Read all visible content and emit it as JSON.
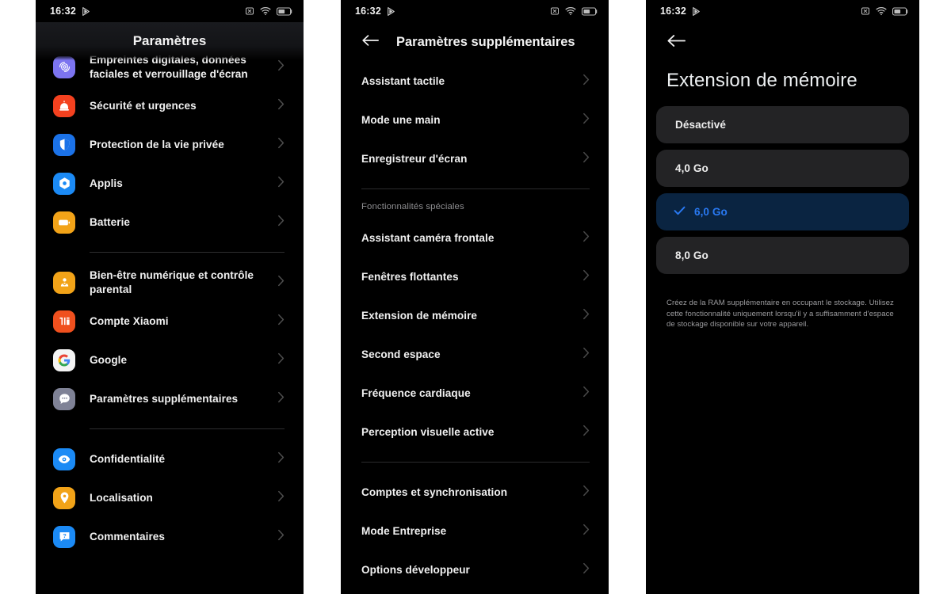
{
  "statusbar": {
    "time": "16:32",
    "play_icon": "play-triangle-icon",
    "icons": [
      "silent-mode-icon",
      "wifi-icon",
      "battery-icon"
    ],
    "battery_level": "53"
  },
  "panel1": {
    "header_title": "Paramètres",
    "groups": [
      {
        "items": [
          {
            "label": "Empreintes digitales, données faciales et verrouillage d'écran",
            "icon": "fingerprint-icon",
            "icon_bg": "#7c74f0",
            "partial": true
          },
          {
            "label": "Sécurité et urgences",
            "icon": "emergency-icon",
            "icon_bg": "#f4411f"
          },
          {
            "label": "Protection de la vie privée",
            "icon": "privacy-shield-icon",
            "icon_bg": "#1b72e8"
          },
          {
            "label": "Applis",
            "icon": "apps-icon",
            "icon_bg": "#1b8af5"
          },
          {
            "label": "Batterie",
            "icon": "battery-icon",
            "icon_bg": "#f2a318"
          }
        ]
      },
      {
        "items": [
          {
            "label": "Bien-être numérique et contrôle parental",
            "icon": "digital-wellbeing-icon",
            "icon_bg": "#f2a318"
          },
          {
            "label": "Compte Xiaomi",
            "icon": "xiaomi-mi-icon",
            "icon_bg": "#f0501e"
          },
          {
            "label": "Google",
            "icon": "google-g-icon",
            "icon_bg": "#f4f4f4"
          },
          {
            "label": "Paramètres supplémentaires",
            "icon": "more-dots-icon",
            "icon_bg": "#7f8296"
          }
        ]
      },
      {
        "items": [
          {
            "label": "Confidentialité",
            "icon": "eye-icon",
            "icon_bg": "#1b8af5"
          },
          {
            "label": "Localisation",
            "icon": "location-pin-icon",
            "icon_bg": "#f2a318"
          },
          {
            "label": "Commentaires",
            "icon": "feedback-question-icon",
            "icon_bg": "#1b8af5"
          }
        ]
      }
    ],
    "chevron_icon": "chevron-right-icon"
  },
  "panel2": {
    "back_icon": "back-arrow-icon",
    "header_title": "Paramètres supplémentaires",
    "groups": [
      {
        "title": null,
        "items": [
          {
            "label": "Assistant tactile"
          },
          {
            "label": "Mode une main"
          },
          {
            "label": "Enregistreur d'écran"
          }
        ]
      },
      {
        "title": "Fonctionnalités spéciales",
        "items": [
          {
            "label": "Assistant caméra frontale"
          },
          {
            "label": "Fenêtres flottantes"
          },
          {
            "label": "Extension de mémoire"
          },
          {
            "label": "Second espace"
          },
          {
            "label": "Fréquence cardiaque"
          },
          {
            "label": "Perception visuelle active"
          }
        ]
      },
      {
        "title": null,
        "items": [
          {
            "label": "Comptes et synchronisation"
          },
          {
            "label": "Mode Entreprise"
          },
          {
            "label": "Options développeur"
          }
        ]
      }
    ],
    "chevron_icon": "chevron-right-icon"
  },
  "panel3": {
    "back_icon": "back-arrow-icon",
    "title": "Extension de mémoire",
    "check_icon": "checkmark-icon",
    "options": [
      {
        "label": "Désactivé",
        "selected": false
      },
      {
        "label": "4,0 Go",
        "selected": false
      },
      {
        "label": "6,0 Go",
        "selected": true
      },
      {
        "label": "8,0 Go",
        "selected": false
      }
    ],
    "description": "Créez de la RAM supplémentaire en occupant le stockage. Utilisez cette fonctionnalité uniquement lorsqu'il y a suffisamment d'espace de stockage disponible sur votre appareil.",
    "accent_color": "#2979f2",
    "selected_bg": "#0a2441"
  }
}
